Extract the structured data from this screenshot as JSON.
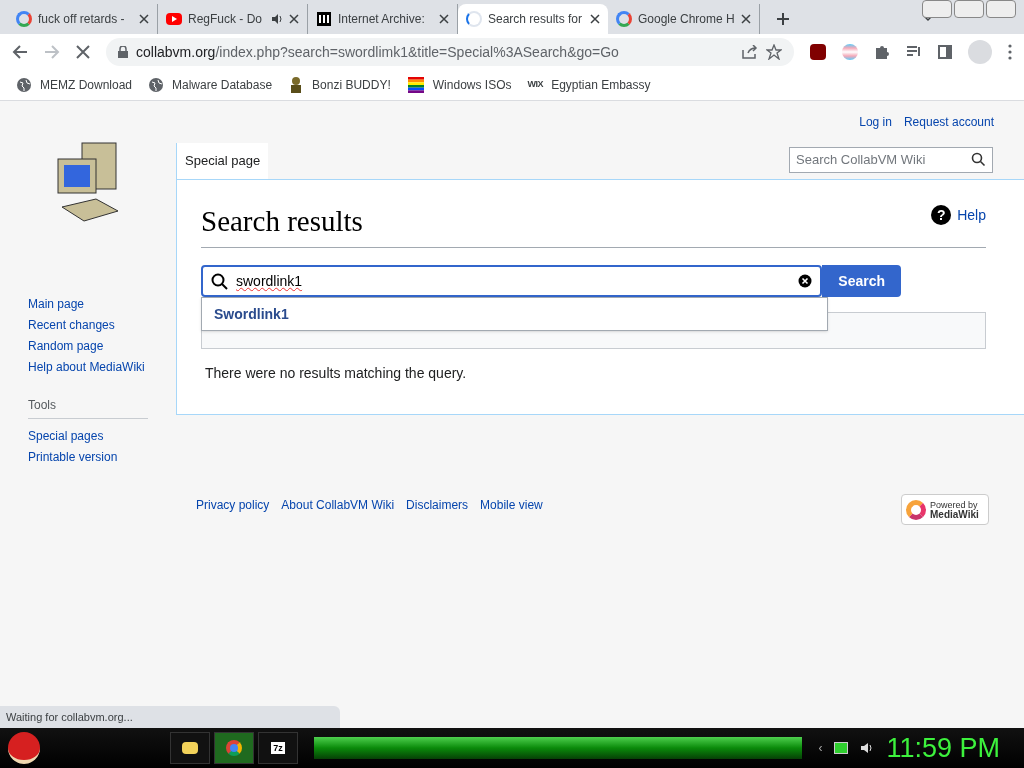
{
  "tabs": [
    {
      "title": "fuck off retards -",
      "kind": "google",
      "selected": false,
      "audio": false
    },
    {
      "title": "RegFuck - Do",
      "kind": "video",
      "selected": false,
      "audio": true
    },
    {
      "title": "Internet Archive:",
      "kind": "archive",
      "selected": false,
      "audio": false
    },
    {
      "title": "Search results for",
      "kind": "loading",
      "selected": true,
      "audio": false
    },
    {
      "title": "Google Chrome H",
      "kind": "google",
      "selected": false,
      "audio": false
    }
  ],
  "address": {
    "host": "collabvm.org",
    "path": "/index.php?search=swordlimk1&title=Special%3ASearch&go=Go",
    "loading": true
  },
  "bookmarks": [
    {
      "label": "MEMZ Download",
      "kind": "globe"
    },
    {
      "label": "Malware Database",
      "kind": "globe"
    },
    {
      "label": "Bonzi BUDDY!",
      "kind": "figure"
    },
    {
      "label": "Windows ISOs",
      "kind": "rainbow"
    },
    {
      "label": "Egyptian Embassy",
      "kind": "wix",
      "icon_text": "WIX"
    }
  ],
  "wiki": {
    "personal_links": [
      "Log in",
      "Request account"
    ],
    "search_placeholder": "Search CollabVM Wiki",
    "page_tab": "Special page",
    "heading": "Search results",
    "help": "Help",
    "help_symbol": "?",
    "query": "swordlink1",
    "search_button": "Search",
    "suggestion": "Swordlink1",
    "no_results": "There were no results matching the query.",
    "navigation": [
      "Main page",
      "Recent changes",
      "Random page",
      "Help about MediaWiki"
    ],
    "tools_heading": "Tools",
    "tools": [
      "Special pages",
      "Printable version"
    ],
    "footer": [
      "Privacy policy",
      "About CollabVM Wiki",
      "Disclaimers",
      "Mobile view"
    ],
    "powered_by": [
      "Powered by",
      "MediaWiki"
    ]
  },
  "status": "Waiting for collabvm.org...",
  "taskbar": {
    "apps": [
      {
        "kind": "folder",
        "selected": false
      },
      {
        "kind": "chrome",
        "selected": true
      },
      {
        "kind": "archiver",
        "label": "7z",
        "selected": false
      }
    ],
    "tray_arrow": "‹",
    "clock": "11:59 PM"
  }
}
